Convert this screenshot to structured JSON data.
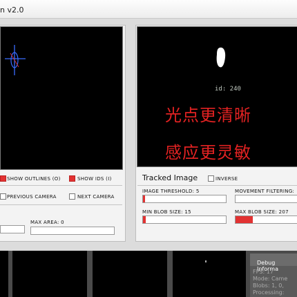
{
  "window": {
    "title_fragment": "n v2.0"
  },
  "tracked": {
    "blob_label": "id: 240",
    "overlay_line1": "光点更清晰",
    "overlay_line2": "感应更灵敏",
    "title": "Tracked Image",
    "inverse_label": "INVERSE",
    "threshold_label": "IMAGE THRESHOLD: 5",
    "threshold_value": 5,
    "movement_label": "MOVEMENT FILTERING:",
    "min_blob_label": "MIN BLOB SIZE: 15",
    "min_blob_value": 15,
    "max_blob_label": "MAX BLOB SIZE: 207",
    "max_blob_value": 207
  },
  "source": {
    "show_outlines_label": "SHOW OUTLINES (O)",
    "show_ids_label": "SHOW IDS (I)",
    "previous_camera_label": "PREVIOUS CAMERA",
    "next_camera_label": "NEXT CAMERA",
    "max_area_label": "MAX AREA: 0"
  },
  "debug": {
    "title": "Debug Informa",
    "fps": "FPS: 17",
    "mode": "Mode: Came",
    "blobs": "Blobs: 1, 0,",
    "processing": "Processing:"
  },
  "colors": {
    "accent": "#e23232",
    "overlay_text": "#e32222",
    "crosshair": "#3a6cff"
  }
}
